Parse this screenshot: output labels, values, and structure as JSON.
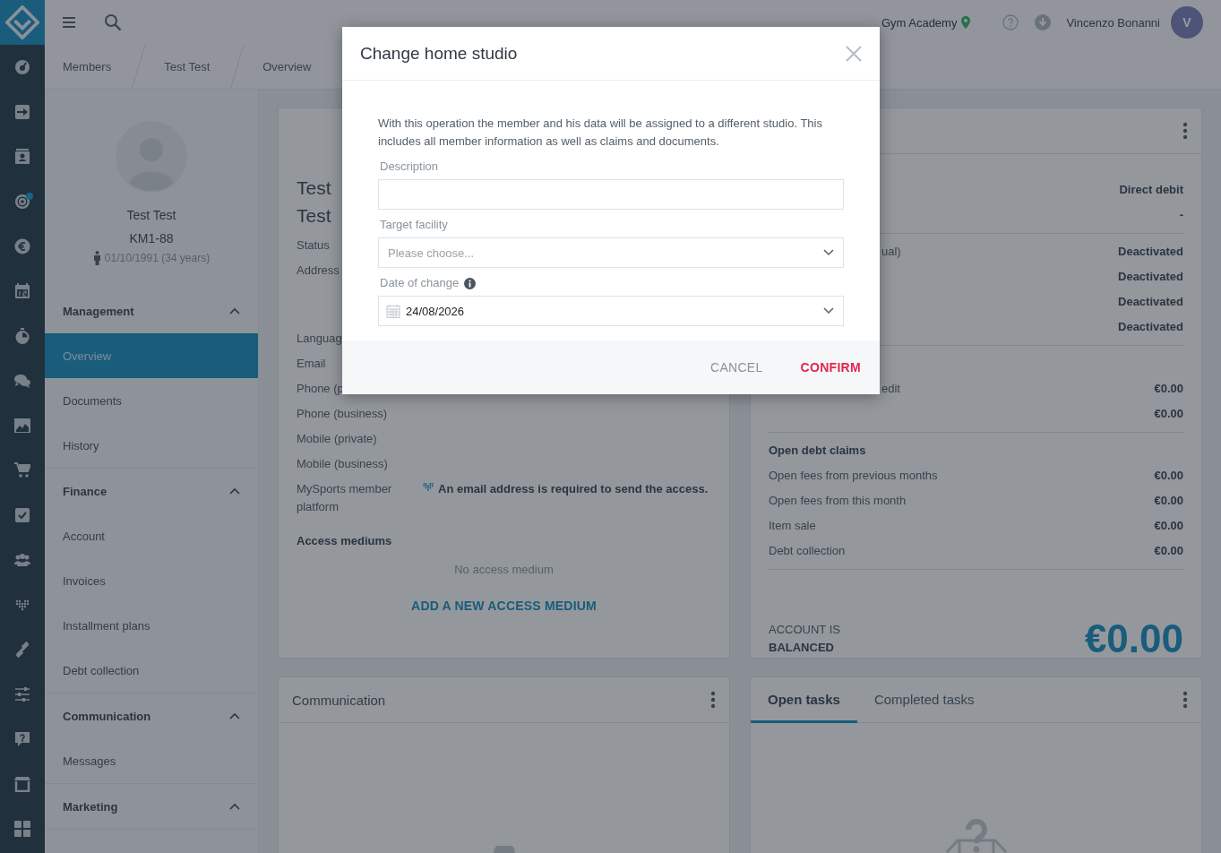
{
  "rail": {
    "items": [
      {
        "badge": false
      },
      {
        "badge": false
      },
      {
        "badge": false
      },
      {
        "badge": true
      },
      {
        "badge": false
      },
      {
        "badge": false
      },
      {
        "badge": false
      },
      {
        "badge": false
      },
      {
        "badge": false
      },
      {
        "badge": false
      },
      {
        "badge": false
      },
      {
        "badge": false
      },
      {
        "badge": false
      },
      {
        "badge": false
      },
      {
        "badge": false
      },
      {
        "badge": false
      },
      {
        "badge": false
      },
      {
        "badge": false
      }
    ]
  },
  "top_bar": {
    "studio": "Gym Academy",
    "user_name": "Vincenzo Bonanni",
    "avatar_initial": "V"
  },
  "breadcrumbs": [
    "Members",
    "Test Test",
    "Overview"
  ],
  "profile": {
    "name": "Test Test",
    "member_id": "KM1-88",
    "birth": "01/10/1991 (34 years)"
  },
  "nav": [
    {
      "title": "Management",
      "expanded": true,
      "items": [
        {
          "label": "Overview",
          "selected": true
        },
        {
          "label": "Documents",
          "selected": false
        },
        {
          "label": "History",
          "selected": false
        }
      ]
    },
    {
      "title": "Finance",
      "expanded": true,
      "items": [
        {
          "label": "Account",
          "selected": false
        },
        {
          "label": "Invoices",
          "selected": false
        },
        {
          "label": "Installment plans",
          "selected": false
        },
        {
          "label": "Debt collection",
          "selected": false
        }
      ]
    },
    {
      "title": "Communication",
      "expanded": true,
      "items": [
        {
          "label": "Messages",
          "selected": false
        }
      ]
    },
    {
      "title": "Marketing",
      "expanded": true
    }
  ],
  "member_card": {
    "first_name": "Test",
    "last_name": "Test",
    "fields": [
      {
        "kind": "line",
        "label": "Status"
      },
      {
        "kind": "block",
        "label": "Address"
      },
      {
        "kind": "line",
        "label": "Languag"
      },
      {
        "kind": "line",
        "label": "Email"
      },
      {
        "kind": "line",
        "label": "Phone (p"
      },
      {
        "kind": "line",
        "label": "Phone (business)"
      },
      {
        "kind": "line",
        "label": "Mobile (private)"
      },
      {
        "kind": "line",
        "label": "Mobile (business)"
      },
      {
        "kind": "note",
        "label": "MySports member platform",
        "note": "An email address is required to send the access."
      }
    ],
    "access_heading": "Access mediums",
    "access_empty": "No access medium",
    "access_link": "ADD A NEW ACCESS MEDIUM"
  },
  "finance_card": {
    "sections": [
      {
        "rows": [
          {
            "value": "Direct debit"
          },
          {
            "value": "-"
          }
        ]
      },
      {
        "rows": [
          {
            "label": "ual)",
            "value": "Deactivated"
          },
          {
            "value": "Deactivated"
          },
          {
            "value": "Deactivated"
          },
          {
            "value": "Deactivated"
          }
        ]
      },
      {
        "rows": [
          {
            "label": "edit",
            "value": "€0.00"
          },
          {
            "value": "€0.00"
          }
        ]
      },
      {
        "heading": "Open debt claims",
        "rows": [
          {
            "label": "Open fees from previous months",
            "value": "€0.00"
          },
          {
            "label": "Open fees from this month",
            "value": "€0.00"
          },
          {
            "label": "Item sale",
            "value": "€0.00"
          },
          {
            "label": "Debt collection",
            "value": "€0.00"
          }
        ]
      }
    ],
    "balance_line1": "ACCOUNT IS",
    "balance_line2": "BALANCED",
    "balance": "€0.00"
  },
  "communication_card": {
    "title": "Communication"
  },
  "tasks_card": {
    "tabs": [
      {
        "label": "Open tasks",
        "selected": true
      },
      {
        "label": "Completed tasks",
        "selected": false
      }
    ]
  },
  "dialog": {
    "title": "Change home studio",
    "intro": "With this operation the member and his data will be assigned to a different studio. This includes all member information as well as claims and documents.",
    "fields": [
      {
        "kind": "text",
        "label": "Description"
      },
      {
        "kind": "select",
        "label": "Target facility",
        "placeholder": "Please choose..."
      },
      {
        "kind": "date",
        "label": "Date of change",
        "info": true,
        "value": "24/08/2026"
      }
    ],
    "buttons": [
      {
        "kind": "secondary",
        "label": "CANCEL"
      },
      {
        "kind": "primary",
        "label": "CONFIRM"
      }
    ]
  }
}
